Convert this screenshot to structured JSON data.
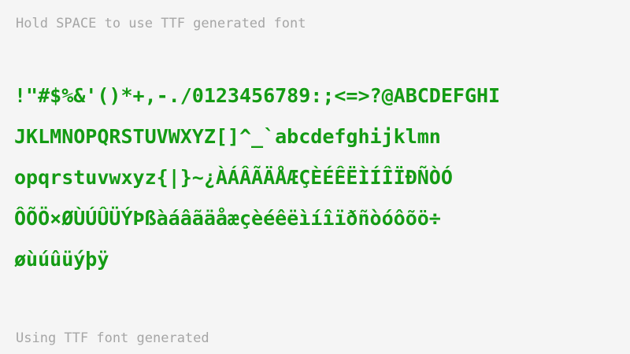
{
  "hint_text": "Hold SPACE to use TTF generated font",
  "sample": {
    "lines": [
      "!\"#$%&'()*+,-./0123456789:;<=>?@ABCDEFGHI",
      "JKLMNOPQRSTUVWXYZ[]^_`abcdefghijklmn",
      "opqrstuvwxyz{|}~¿ÀÁÂÃÄÅÆÇÈÉÊËÌÍÎÏÐÑÒÓ",
      "ÔÕÖ×ØÙÚÛÜÝÞßàáâãäåæçèéêëìíîïðñòóôõö÷",
      "øùúûüýþÿ"
    ]
  },
  "status_text": "Using TTF font generated",
  "colors": {
    "background": "#f5f5f5",
    "sample_text": "#149b14",
    "hint_text": "#a6a6a6"
  }
}
